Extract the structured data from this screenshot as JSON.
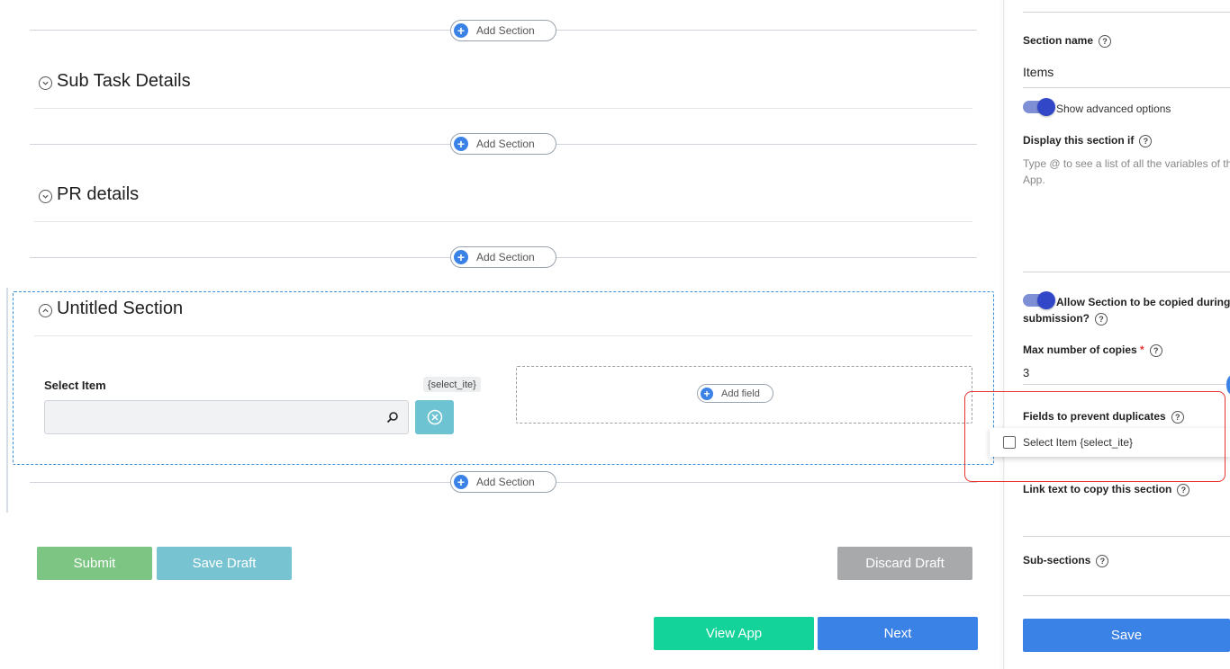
{
  "builder": {
    "add_section_label": "Add Section",
    "sections": [
      {
        "title": "Sub Task Details"
      },
      {
        "title": "PR details"
      },
      {
        "title": "Untitled Section"
      }
    ],
    "field": {
      "label": "Select Item",
      "variable_chip": "{select_ite}",
      "value": "",
      "placeholder": ""
    },
    "add_field_label": "Add field"
  },
  "form_actions": {
    "submit": "Submit",
    "save_draft": "Save Draft",
    "discard_draft": "Discard Draft"
  },
  "nav_actions": {
    "view_app": "View App",
    "next": "Next"
  },
  "panel": {
    "section_name_label": "Section name",
    "section_name_value": "Items",
    "show_advanced_label": "Show advanced options",
    "show_advanced_on": true,
    "display_if_label": "Display this section if",
    "display_if_placeholder_line1": "Type @ to see a list of all the variables of the",
    "display_if_placeholder_line2": "App.",
    "allow_copy_line1": "Allow Section to be copied during",
    "allow_copy_line2": "submission?",
    "allow_copy_on": true,
    "max_copies_label": "Max number of copies",
    "max_copies_required": "*",
    "max_copies_value": "3",
    "prevent_duplicates_label": "Fields to prevent duplicates",
    "prevent_duplicates_option": "Select Item {select_ite}",
    "link_text_label": "Link text to copy this section",
    "sub_sections_label": "Sub-sections",
    "save_label": "Save",
    "help_glyph": "?"
  },
  "colors": {
    "accent_blue": "#3b82e6",
    "submit_green": "#7dc583",
    "save_draft_teal": "#77c3d1",
    "discard_gray": "#a7a9ab",
    "view_app_green": "#14d39a",
    "highlight_red": "#e3342f",
    "toggle_knob": "#3147c8"
  },
  "icons": [
    "plus-circle-icon",
    "chevron-down-icon",
    "chevron-up-icon",
    "search-icon",
    "clear-icon",
    "help-icon",
    "checkbox-icon"
  ]
}
